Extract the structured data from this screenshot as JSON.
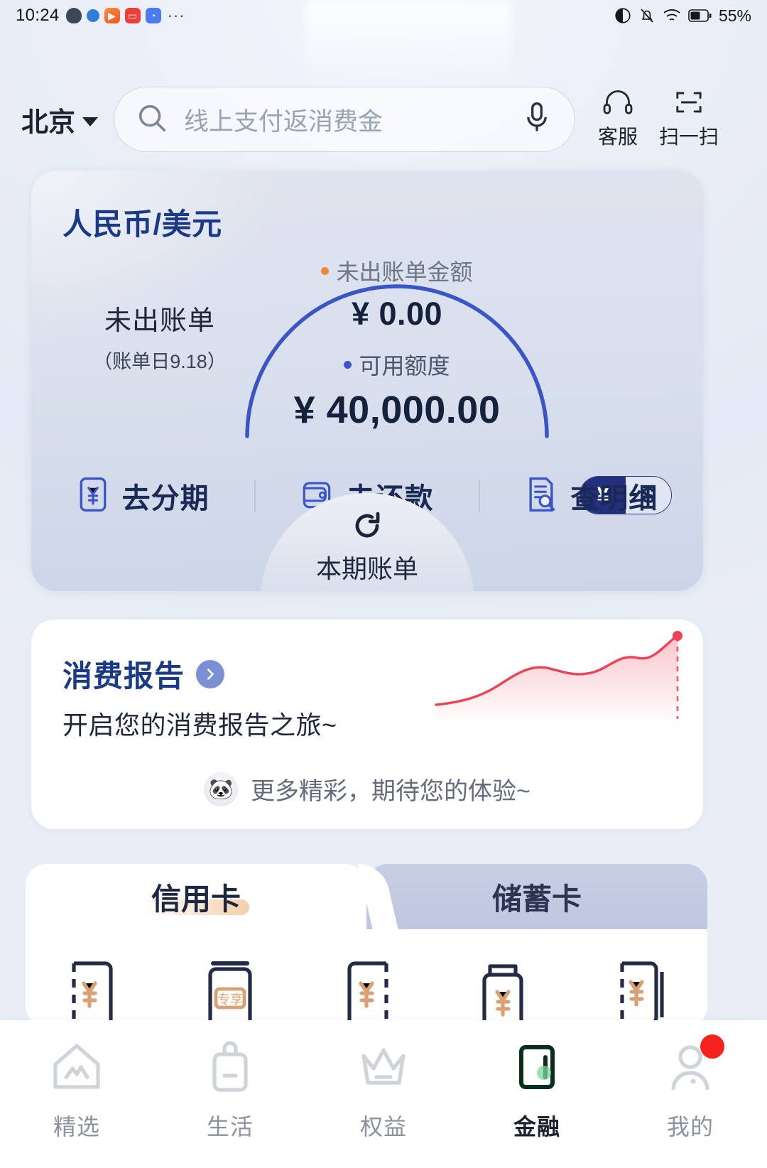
{
  "statusbar": {
    "time": "10:24",
    "icons": [
      "shield-icon",
      "dot-icon",
      "play-icon",
      "record-icon",
      "app-icon",
      "overflow-dots-icon"
    ],
    "right_icons": [
      "eye-care-icon",
      "mute-bell-icon",
      "wifi-icon",
      "battery-icon"
    ],
    "battery": "55%"
  },
  "topbar": {
    "city": "北京",
    "search_placeholder": "线上支付返消费金",
    "search_value": "",
    "mic_icon": "microphone-icon",
    "search_icon": "search-icon",
    "actions": [
      {
        "label": "客服",
        "icon": "headphone-icon"
      },
      {
        "label": "扫一扫",
        "icon": "scan-icon"
      }
    ]
  },
  "credit_card_panel": {
    "title": "人民币/美元",
    "left": {
      "label": "未出账单",
      "sub": "（账单日9.18）"
    },
    "gauge": {
      "unbilled_caption": "未出账单金额",
      "unbilled_value": "¥ 0.00",
      "available_caption": "可用额度",
      "available_value": "¥ 40,000.00",
      "arc_color": "#3a55c8",
      "unbilled_dot_color": "#f0873c",
      "available_dot_color": "#3a55c8"
    },
    "currency_switch": {
      "options": [
        "¥",
        "$"
      ],
      "selected": "¥",
      "active_bg": "#22307e"
    },
    "actions": [
      {
        "label": "去分期",
        "icon": "yen-document-icon"
      },
      {
        "label": "去还款",
        "icon": "wallet-icon"
      },
      {
        "label": "查明细",
        "icon": "document-search-icon"
      }
    ],
    "bump": {
      "label": "本期账单",
      "icon": "refresh-icon"
    }
  },
  "report_card": {
    "title": "消费报告",
    "chevron_icon": "chevron-right-icon",
    "subtitle": "开启您的消费报告之旅~",
    "footer_text": "更多精彩，期待您的体验~",
    "footer_emoji_icon": "panda-emoji-icon",
    "chart_color": "#ef4054"
  },
  "card_list": {
    "tabs": [
      {
        "label": "信用卡",
        "active": true
      },
      {
        "label": "储蓄卡",
        "active": false
      }
    ],
    "card_icons": [
      "yen-card-icon",
      "exclusive-card-icon",
      "yen-card-dashed-icon",
      "yen-wallet-icon",
      "yen-multi-card-icon"
    ],
    "exclusive_badge": "专享"
  },
  "bottom_nav": {
    "items": [
      {
        "label": "精选",
        "icon": "home-icon",
        "active": false,
        "badge": false
      },
      {
        "label": "生活",
        "icon": "bag-icon",
        "active": false,
        "badge": false
      },
      {
        "label": "权益",
        "icon": "crown-icon",
        "active": false,
        "badge": false
      },
      {
        "label": "金融",
        "icon": "finance-phone-icon",
        "active": true,
        "badge": false
      },
      {
        "label": "我的",
        "icon": "person-icon",
        "active": false,
        "badge": true
      }
    ],
    "active_color": "#0c6b3f",
    "badge_color": "#f5221d"
  }
}
